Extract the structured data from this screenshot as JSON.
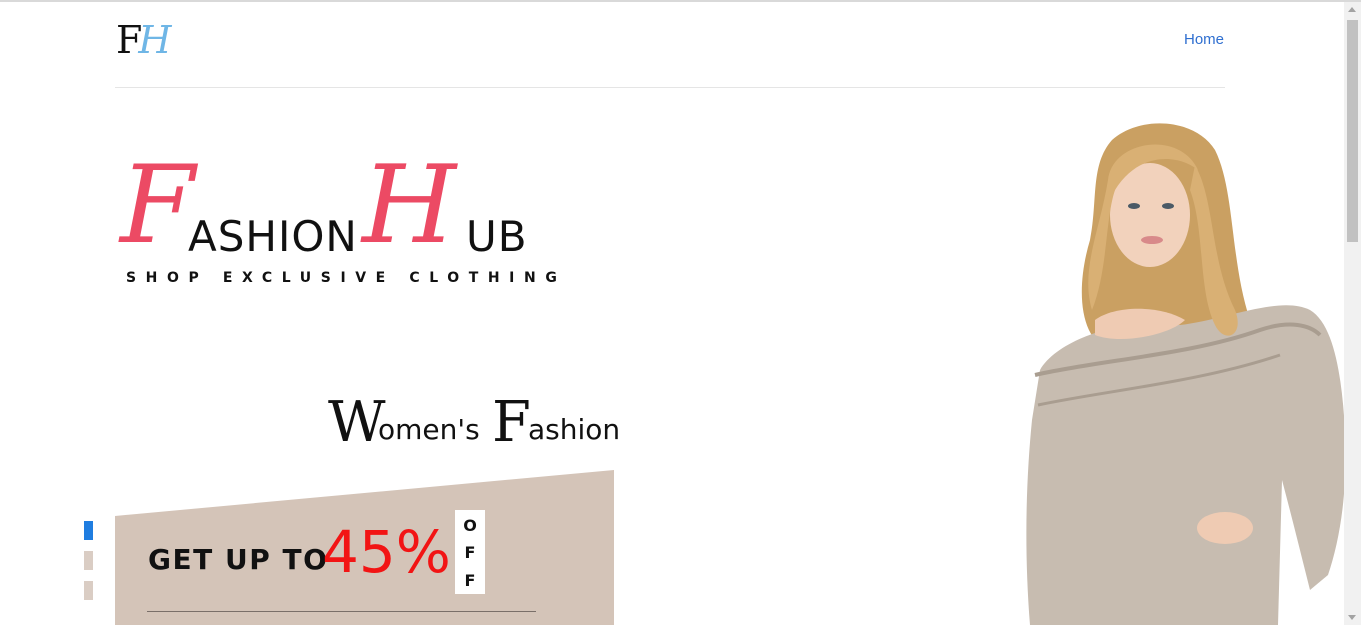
{
  "header": {
    "logo": {
      "letter1": "F",
      "letter2": "H"
    },
    "nav": [
      {
        "label": "Home"
      }
    ]
  },
  "hero": {
    "brand": {
      "cap1": "F",
      "word1": "ASHION",
      "cap2": "H",
      "word2": "UB",
      "tagline": "SHOP EXCLUSIVE CLOTHING"
    },
    "section_title": {
      "cap1": "W",
      "rest1": "omen's",
      "cap2": "F",
      "rest2": "ashion"
    },
    "promo": {
      "text": "GET UP TO",
      "percent": "45%",
      "off_letters": [
        "O",
        "F",
        "F"
      ],
      "bg_color": "#d4c4b8",
      "percent_color": "#f21414"
    },
    "slider": {
      "total": 3,
      "active": 0
    }
  },
  "colors": {
    "accent_pink": "#ec4a64",
    "logo_blue": "#6fb6e6",
    "link_blue": "#2f6fd0",
    "dot_active": "#1f7de0",
    "dot_inactive": "#dacdc4"
  }
}
